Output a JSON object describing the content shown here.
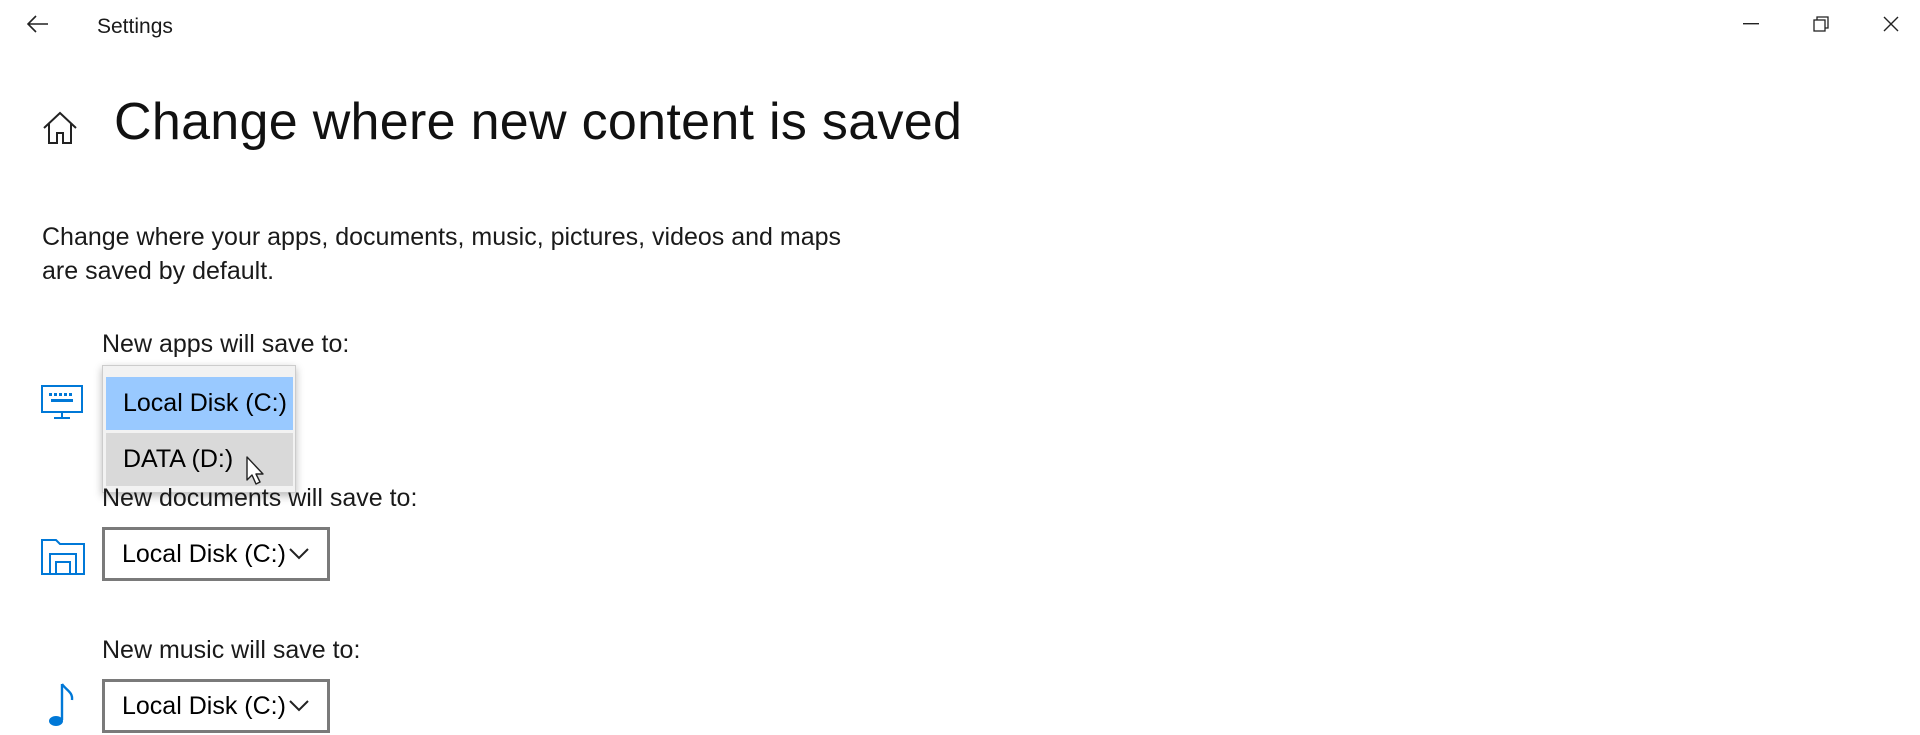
{
  "window": {
    "title": "Settings",
    "controls": {
      "minimize_icon": "minimize-icon",
      "maximize_icon": "restore-icon",
      "close_icon": "close-icon"
    }
  },
  "header": {
    "title": "Change where new content is saved",
    "home_icon": "home-icon"
  },
  "description": {
    "line1": "Change where your apps, documents, music, pictures, videos and maps",
    "line2": "are saved by default."
  },
  "apps": {
    "label": "New apps will save to:",
    "icon": "monitor-keyboard-icon",
    "dropdown_open": true,
    "options": [
      "Local Disk (C:)",
      "DATA (D:)"
    ],
    "selected": "Local Disk (C:)",
    "hovered": "DATA (D:)"
  },
  "documents": {
    "label": "New documents will save to:",
    "icon": "folder-drive-icon",
    "value": "Local Disk (C:)"
  },
  "music": {
    "label": "New music will save to:",
    "icon": "music-note-icon",
    "value": "Local Disk (C:)"
  },
  "colors": {
    "accent": "#0078d7",
    "selection": "#99c9ff",
    "hover": "#d9d9d9",
    "border": "#7a7a7a"
  }
}
